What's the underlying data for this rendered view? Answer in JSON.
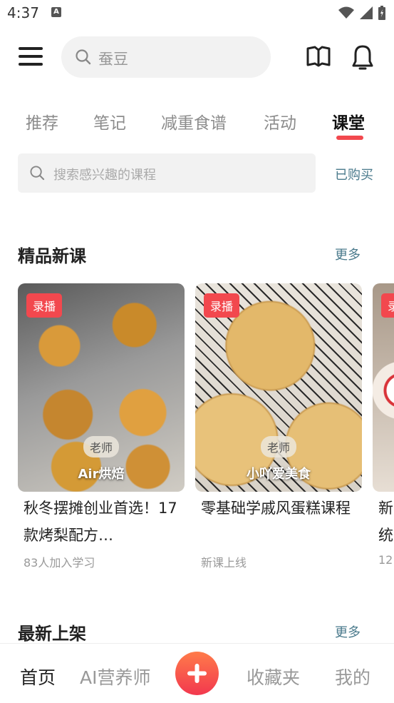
{
  "status_bar": {
    "time": "4:37",
    "a_label": "A"
  },
  "header": {
    "search_placeholder": "蚕豆"
  },
  "tabs": [
    {
      "label": "推荐"
    },
    {
      "label": "笔记"
    },
    {
      "label": "减重食谱"
    },
    {
      "label": "活动"
    },
    {
      "label": "课堂"
    }
  ],
  "active_tab": "课堂",
  "course_search": {
    "placeholder": "搜索感兴趣的课程",
    "purchased": "已购买"
  },
  "sections": {
    "premium": {
      "title": "精品新课",
      "more": "更多"
    },
    "latest": {
      "title": "最新上架",
      "more": "更多"
    }
  },
  "cards": [
    {
      "badge": "录播",
      "teacher_tag": "老师",
      "teacher": "Air烘焙",
      "title": "秋冬摆摊创业首选！17款烤梨配方…",
      "meta": "83人加入学习"
    },
    {
      "badge": "录播",
      "teacher_tag": "老师",
      "teacher": "小吖爱美食",
      "title": "零基础学戚风蛋糕课程",
      "meta": "新课上线"
    },
    {
      "badge": "录播",
      "title_partial": "新\n统",
      "meta_partial": "12"
    }
  ],
  "bottom_nav": [
    {
      "label": "首页"
    },
    {
      "label": "AI营养师"
    },
    {
      "label": "收藏夹"
    },
    {
      "label": "我的"
    }
  ]
}
